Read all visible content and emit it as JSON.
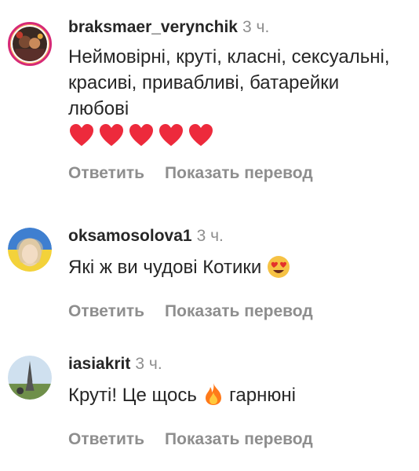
{
  "comments": [
    {
      "username": "braksmaer_verynchik",
      "time": "3 ч.",
      "text": "Неймовірні, круті, класні, сексуальні, красиві, привабливі, батарейки любові",
      "emoji_tail": "❤️❤️❤️❤️❤️",
      "reply_label": "Ответить",
      "translate_label": "Показать перевод"
    },
    {
      "username": "oksamosolova1",
      "time": "3 ч.",
      "text": "Які ж ви чудові Котики",
      "emoji_tail": "😍",
      "reply_label": "Ответить",
      "translate_label": "Показать перевод"
    },
    {
      "username": "iasiakrit",
      "time": "3 ч.",
      "text_before": "Круті! Це щось",
      "emoji_mid": "🔥",
      "text_after": "гарнюні",
      "reply_label": "Ответить",
      "translate_label": "Показать перевод"
    }
  ],
  "colors": {
    "text": "#262626",
    "secondary": "#8e8e8e",
    "heart": "#ed2a3c",
    "fire": "#ff7a1a"
  }
}
